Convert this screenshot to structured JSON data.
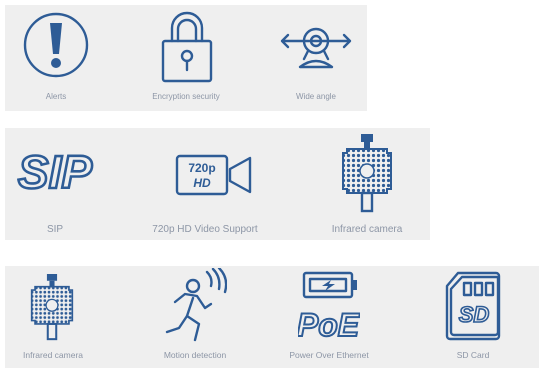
{
  "rows": [
    {
      "features": [
        {
          "icon": "alert-icon",
          "label": "Alerts"
        },
        {
          "icon": "padlock-icon",
          "label": "Encryption security"
        },
        {
          "icon": "wide-angle-webcam-icon",
          "label": "Wide angle"
        }
      ]
    },
    {
      "features": [
        {
          "icon": "sip-text-icon",
          "text": "SIP",
          "label": "SIP"
        },
        {
          "icon": "hd-video-camera-icon",
          "text_top": "720p",
          "text_bottom": "HD",
          "label": "720p HD Video Support"
        },
        {
          "icon": "infrared-camera-icon",
          "label": "Infrared camera"
        }
      ]
    },
    {
      "features": [
        {
          "icon": "infrared-camera-icon",
          "label": "Infrared camera"
        },
        {
          "icon": "motion-detection-icon",
          "label": "Motion detection"
        },
        {
          "icon": "power-over-ethernet-icon",
          "text": "PoE",
          "label": "Power Over Ethernet"
        },
        {
          "icon": "sd-card-icon",
          "text": "SD",
          "label": "SD Card"
        }
      ]
    }
  ],
  "colors": {
    "icon": "#2e5c96",
    "label": "#8d96a6",
    "panel": "#efefef"
  }
}
